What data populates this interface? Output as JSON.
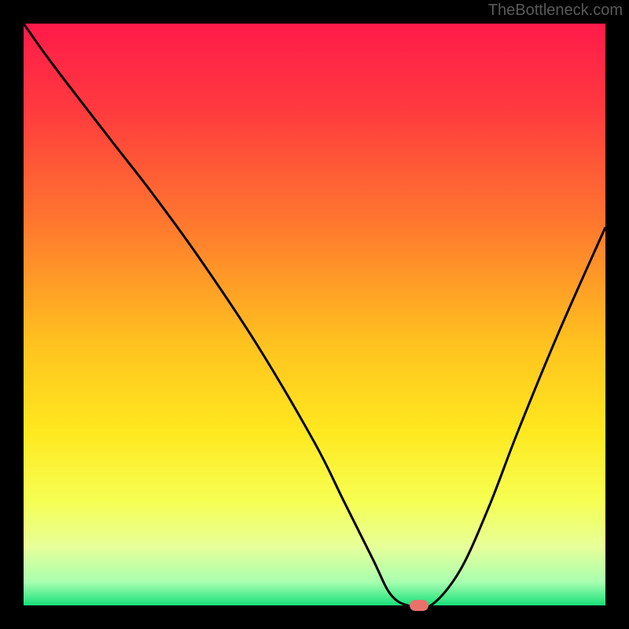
{
  "watermark": "TheBottleneck.com",
  "colors": {
    "background_black": "#000000",
    "gradient_stops": [
      {
        "offset": 0.0,
        "color": "#ff1a4a"
      },
      {
        "offset": 0.15,
        "color": "#ff3b3e"
      },
      {
        "offset": 0.35,
        "color": "#ff7a2e"
      },
      {
        "offset": 0.55,
        "color": "#ffc21f"
      },
      {
        "offset": 0.7,
        "color": "#ffe81f"
      },
      {
        "offset": 0.82,
        "color": "#f6ff52"
      },
      {
        "offset": 0.9,
        "color": "#e7ff9a"
      },
      {
        "offset": 0.96,
        "color": "#a8ffb0"
      },
      {
        "offset": 1.0,
        "color": "#18e07a"
      }
    ],
    "curve": "#000000",
    "marker": "#e8716b"
  },
  "chart_data": {
    "type": "line",
    "title": "",
    "xlabel": "",
    "ylabel": "",
    "xlim": [
      0,
      100
    ],
    "ylim": [
      0,
      100
    ],
    "series": [
      {
        "name": "bottleneck-curve",
        "x": [
          0,
          5,
          15,
          22,
          30,
          40,
          50,
          55,
          60,
          63,
          66,
          70,
          75,
          80,
          85,
          92,
          100
        ],
        "y": [
          100,
          93,
          80,
          71,
          60,
          45,
          28,
          18,
          8,
          2,
          0,
          0,
          6,
          17,
          30,
          47,
          65
        ]
      }
    ],
    "annotations": [
      {
        "name": "optimal-marker",
        "x": 68,
        "y": 0
      }
    ],
    "legend": false,
    "grid": false
  }
}
